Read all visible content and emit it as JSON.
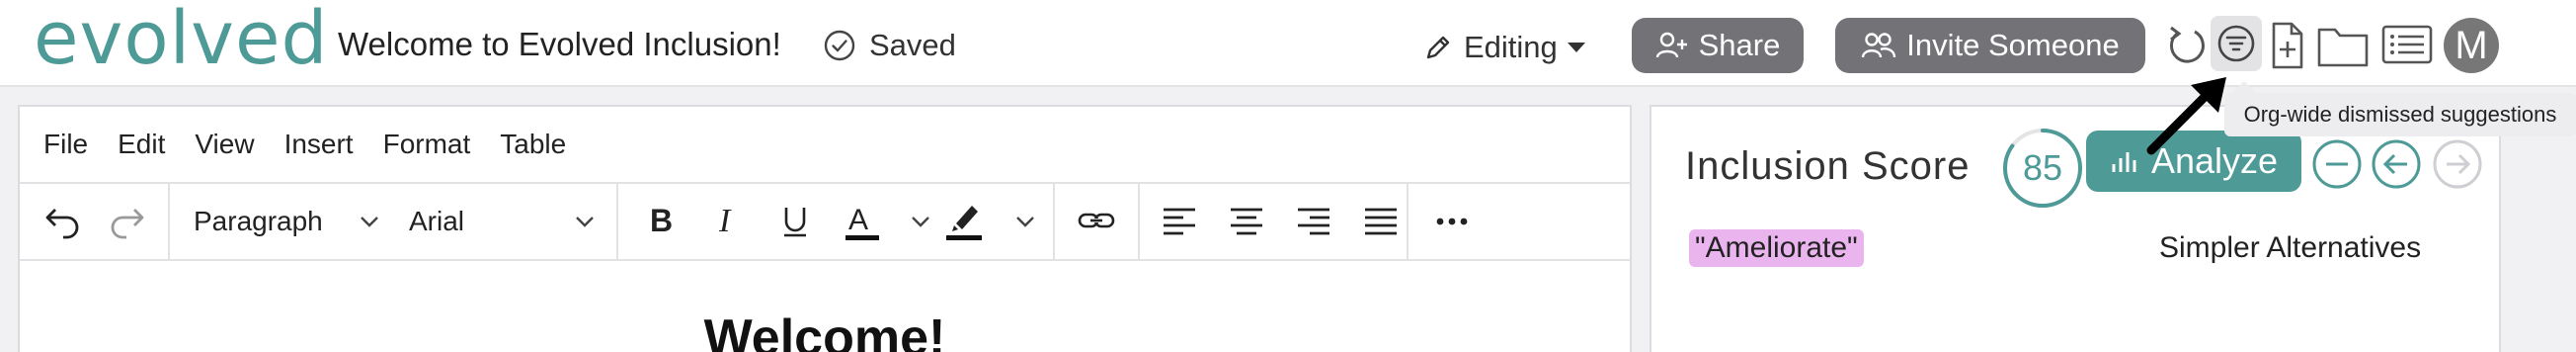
{
  "header": {
    "logo": "evolved",
    "doc_title": "Welcome to Evolved Inclusion!",
    "saved_label": "Saved",
    "mode_label": "Editing",
    "share_label": "Share",
    "invite_label": "Invite Someone",
    "avatar_initial": "M",
    "icons": [
      "pencil-icon",
      "undo-history-icon",
      "filter-icon",
      "new-file-icon",
      "folder-icon",
      "list-icon"
    ]
  },
  "tooltip": {
    "text": "Org-wide dismissed suggestions"
  },
  "editor": {
    "menu": [
      "File",
      "Edit",
      "View",
      "Insert",
      "Format",
      "Table"
    ],
    "block_format": "Paragraph",
    "font_family": "Arial",
    "heading": "Welcome!"
  },
  "panel": {
    "score_label": "Inclusion Score",
    "score": "85",
    "score_value": 85,
    "analyze_label": "Analyze",
    "flagged_word": "\"Ameliorate\"",
    "alternatives_label": "Simpler Alternatives"
  },
  "colors": {
    "brand": "#4e9a97",
    "pill": "#737277",
    "highlight": "#eab5ee"
  }
}
